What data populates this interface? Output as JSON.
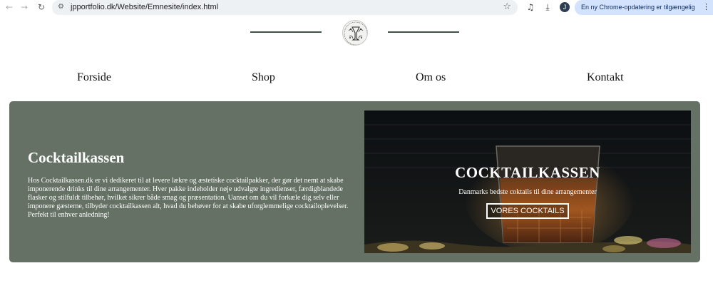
{
  "browser": {
    "url": "jpportfolio.dk/Website/Emnesite/index.html",
    "profile_initial": "J",
    "update_notice": "En ny Chrome-opdatering er tilgængelig",
    "icons": [
      "back-arrow-icon",
      "forward-arrow-icon",
      "reload-icon",
      "site-info-icon",
      "star-icon",
      "media-controls-icon",
      "download-icon",
      "more-menu-icon"
    ],
    "accent_color": "#d3e3fd"
  },
  "header": {
    "logo_line_color": "#3e5449"
  },
  "nav": {
    "items": [
      {
        "label": "Forside"
      },
      {
        "label": "Shop"
      },
      {
        "label": "Om os"
      },
      {
        "label": "Kontakt"
      }
    ]
  },
  "hero": {
    "background_color": "#647164",
    "title": "Cocktailkassen",
    "description": "Hos Cocktailkassen.dk er vi dedikeret til at levere lækre og æstetiske cocktailpakker, der gør det nemt at skabe imponerende drinks til dine arrangementer. Hver pakke indeholder nøje udvalgte ingredienser, færdigblandede flasker og stilfuldt tilbehør, hvilket sikrer både smag og præsentation. Uanset om du vil forkæle dig selv eller imponere gæsterne, tilbyder cocktailkassen alt, hvad du behøver for at skabe uforglemmelige cocktailoplevelser. Perfekt til enhver anledning!",
    "image": {
      "title": "COCKTAILKASSEN",
      "subtitle": "Danmarks bedste coktails til dine arrangementer",
      "button_label": "VORES COCKTAILS"
    }
  }
}
